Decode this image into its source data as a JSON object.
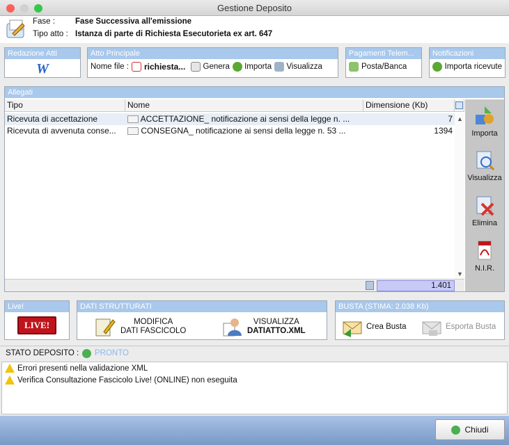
{
  "window": {
    "title": "Gestione Deposito"
  },
  "header": {
    "fase_label": "Fase :",
    "fase_value": "Fase Successiva all'emissione",
    "tipo_label": "Tipo atto :",
    "tipo_value": "Istanza di parte di Richiesta Esecutorieta ex art. 647"
  },
  "redazione": {
    "title": "Redazione Atti"
  },
  "atto": {
    "title": "Atto Principale",
    "nome_label": "Nome file :",
    "nome_value": "richiesta...",
    "genera": "Genera",
    "importa": "Importa",
    "visualizza": "Visualizza"
  },
  "pagamenti": {
    "title": "Pagamenti Telem...",
    "button": "Posta/Banca"
  },
  "notifiche": {
    "title": "Notificazioni",
    "button": "Importa ricevute"
  },
  "allegati": {
    "title": "Allegati",
    "columns": [
      "Tipo",
      "Nome",
      "Dimensione (Kb)"
    ],
    "rows": [
      {
        "tipo": "Ricevuta di accettazione",
        "nome": "ACCETTAZIONE_ notificazione ai sensi della legge n. ...",
        "dim": "7"
      },
      {
        "tipo": "Ricevuta di avvenuta conse...",
        "nome": "CONSEGNA_ notificazione ai sensi della legge n. 53 ...",
        "dim": "1394"
      }
    ],
    "total": "1.401",
    "side": {
      "importa": "Importa",
      "visualizza": "Visualizza",
      "elimina": "Elimina",
      "nir": "N.I.R."
    }
  },
  "live": {
    "title": "Live!",
    "badge": "LIVE!"
  },
  "dati": {
    "title": "DATI STRUTTURATI",
    "modifica_l1": "MODIFICA",
    "modifica_l2": "DATI FASCICOLO",
    "visualizza_l1": "VISUALIZZA",
    "visualizza_l2": "DATIATTO.XML"
  },
  "busta": {
    "title": "BUSTA (STIMA: 2.038 Kb)",
    "crea": "Crea Busta",
    "esporta": "Esporta Busta"
  },
  "stato": {
    "label": "STATO DEPOSITO :",
    "value": "PRONTO"
  },
  "messages": [
    "Errori presenti nella validazione XML",
    "Verifica Consultazione Fascicolo Live! (ONLINE) non eseguita"
  ],
  "footer": {
    "chiudi": "Chiudi"
  },
  "colors": {
    "panel_head": "#a8c8ec",
    "accent": "#2f6bd0",
    "sidebar": "#c6c6c6"
  }
}
